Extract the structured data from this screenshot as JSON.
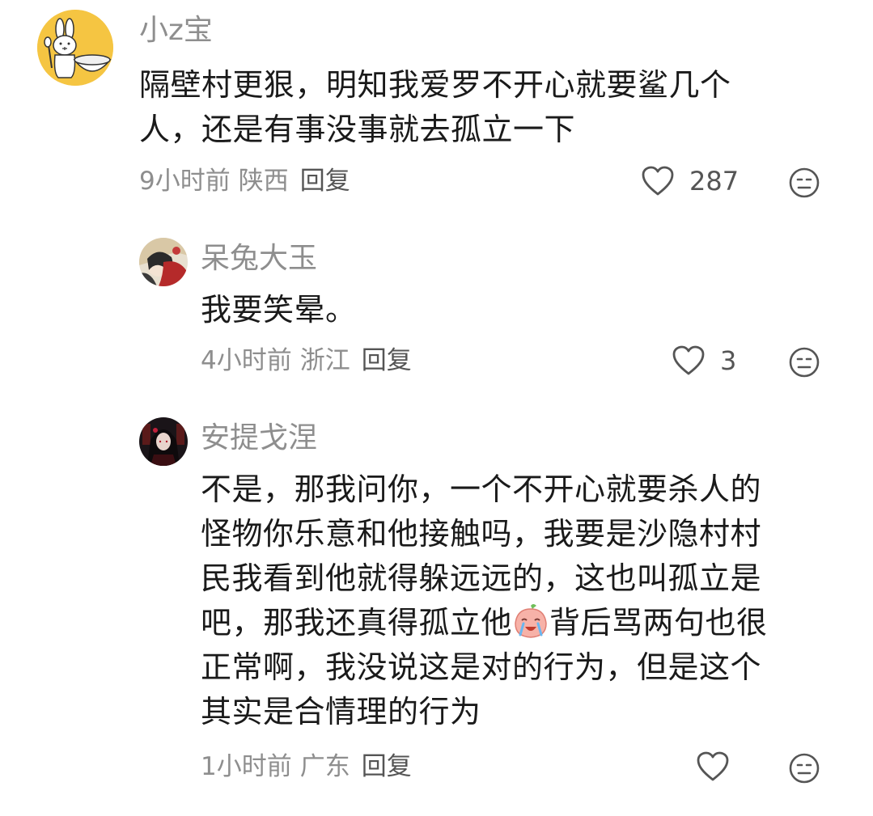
{
  "comments": [
    {
      "username": "小z宝",
      "lines": [
        "隔壁村更狠，明知我爱罗不开心就要鲨几个",
        "人，还是有事没事就去孤立一下"
      ],
      "time": "9小时前",
      "location": "陕西",
      "reply_label": "回复",
      "like_count": "287",
      "avatar": "bunny-with-bowl",
      "avatar_bg": "#f5c542"
    },
    {
      "username": "呆兔大玉",
      "lines": [
        "我要笑晕。"
      ],
      "time": "4小时前",
      "location": "浙江",
      "reply_label": "回复",
      "like_count": "3",
      "avatar": "anime-portrait"
    },
    {
      "username": "安提戈涅",
      "lines": [
        "不是，那我问你，一个不开心就要杀人的",
        "怪物你乐意和他接触吗，我要是沙隐村村",
        "民我看到他就得躲远远的，这也叫孤立是",
        "吧，那我还真得孤立他",
        "背后骂两句也很",
        "正常啊，我没说这是对的行为，但是这个",
        "其实是合情理的行为"
      ],
      "time": "1小时前",
      "location": "广东",
      "reply_label": "回复",
      "like_count": "",
      "avatar": "dark-anime-portrait",
      "inline_emoji": "crying-laughing-peach-emoji"
    }
  ],
  "icons": {
    "like": "heart-outline-icon",
    "react": "neutral-face-icon"
  }
}
